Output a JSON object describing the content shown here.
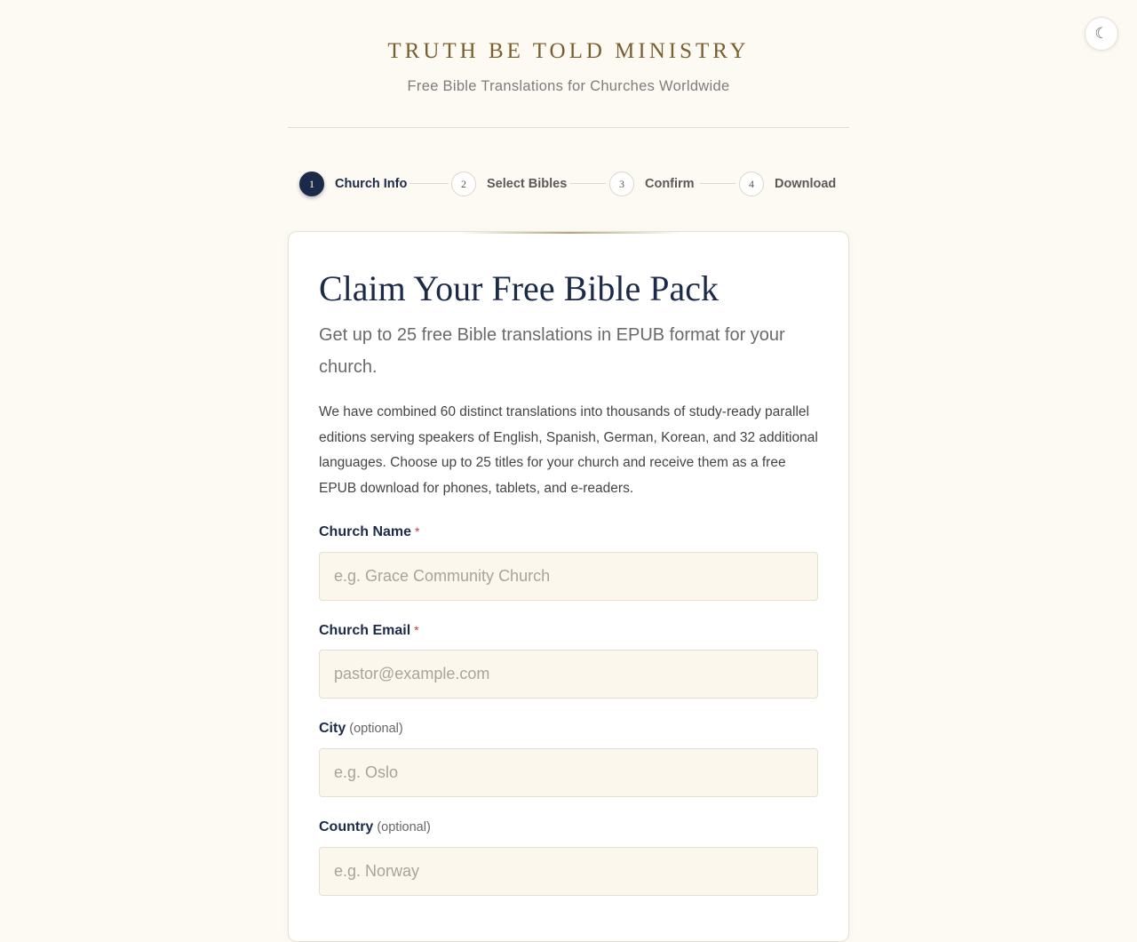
{
  "header": {
    "title": "TRUTH BE TOLD MINISTRY",
    "subtitle": "Free Bible Translations for Churches Worldwide"
  },
  "theme_toggle": {
    "icon": "moon-icon",
    "glyph": "☾"
  },
  "steps": [
    {
      "number": "1",
      "label": "Church Info",
      "active": true
    },
    {
      "number": "2",
      "label": "Select Bibles",
      "active": false
    },
    {
      "number": "3",
      "label": "Confirm",
      "active": false
    },
    {
      "number": "4",
      "label": "Download",
      "active": false
    }
  ],
  "form": {
    "title": "Claim Your Free Bible Pack",
    "lead": "Get up to 25 free Bible translations in EPUB format for your church.",
    "description": "We have combined 60 distinct translations into thousands of study-ready parallel editions serving speakers of English, Spanish, German, Korean, and 32 additional languages. Choose up to 25 titles for your church and receive them as a free EPUB download for phones, tablets, and e-readers.",
    "fields": {
      "church_name": {
        "label": "Church Name",
        "required_mark": "*",
        "value": "",
        "placeholder": "e.g. Grace Community Church"
      },
      "church_email": {
        "label": "Church Email",
        "required_mark": "*",
        "value": "",
        "placeholder": "pastor@example.com"
      },
      "city": {
        "label": "City",
        "optional_note": "(optional)",
        "value": "",
        "placeholder": "e.g. Oslo"
      },
      "country": {
        "label": "Country",
        "optional_note": "(optional)",
        "value": "",
        "placeholder": "e.g. Norway"
      }
    }
  },
  "colors": {
    "background": "#fdfaf4",
    "navy": "#1c2a4a",
    "gold": "#7a5f2e",
    "input_bg": "#fcf7ec",
    "required": "#b8433a"
  }
}
